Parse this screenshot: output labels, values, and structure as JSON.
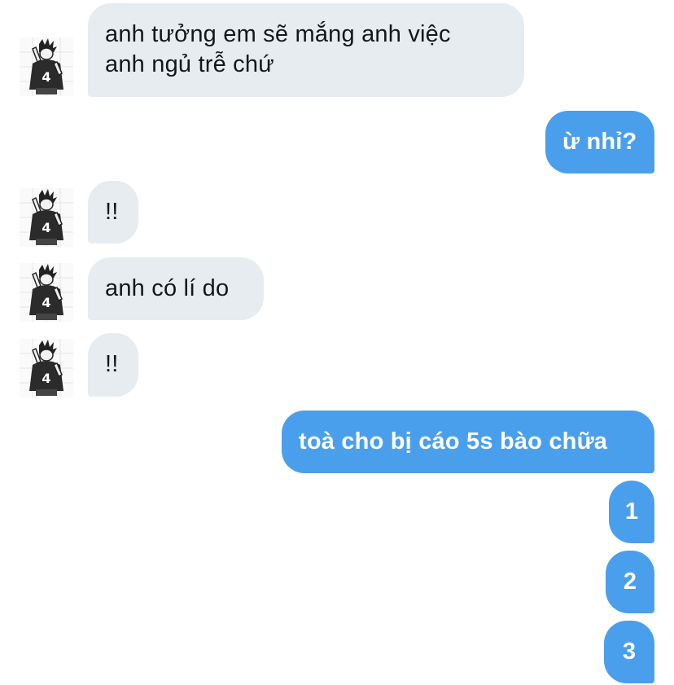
{
  "messages": [
    {
      "direction": "incoming",
      "text": "anh tưởng em sẽ mắng anh việc anh ngủ trễ chứ",
      "line1": "anh tưởng em sẽ mắng anh việc",
      "line2": "anh ngủ trễ chứ"
    },
    {
      "direction": "outgoing",
      "text": "ừ nhỉ?"
    },
    {
      "direction": "incoming",
      "text": "!!"
    },
    {
      "direction": "incoming",
      "text": "anh có lí do"
    },
    {
      "direction": "incoming",
      "text": "!!"
    },
    {
      "direction": "outgoing",
      "text": "toà cho bị cáo 5s bào chữa"
    },
    {
      "direction": "outgoing",
      "text": "1"
    },
    {
      "direction": "outgoing",
      "text": "2"
    },
    {
      "direction": "outgoing",
      "text": "3"
    }
  ],
  "colors": {
    "incoming_bubble": "#e6ecf0",
    "outgoing_bubble": "#4a9fec",
    "incoming_text": "#14171a",
    "outgoing_text": "#ffffff"
  },
  "icons": {
    "avatar": "sender-avatar-manga-character"
  }
}
